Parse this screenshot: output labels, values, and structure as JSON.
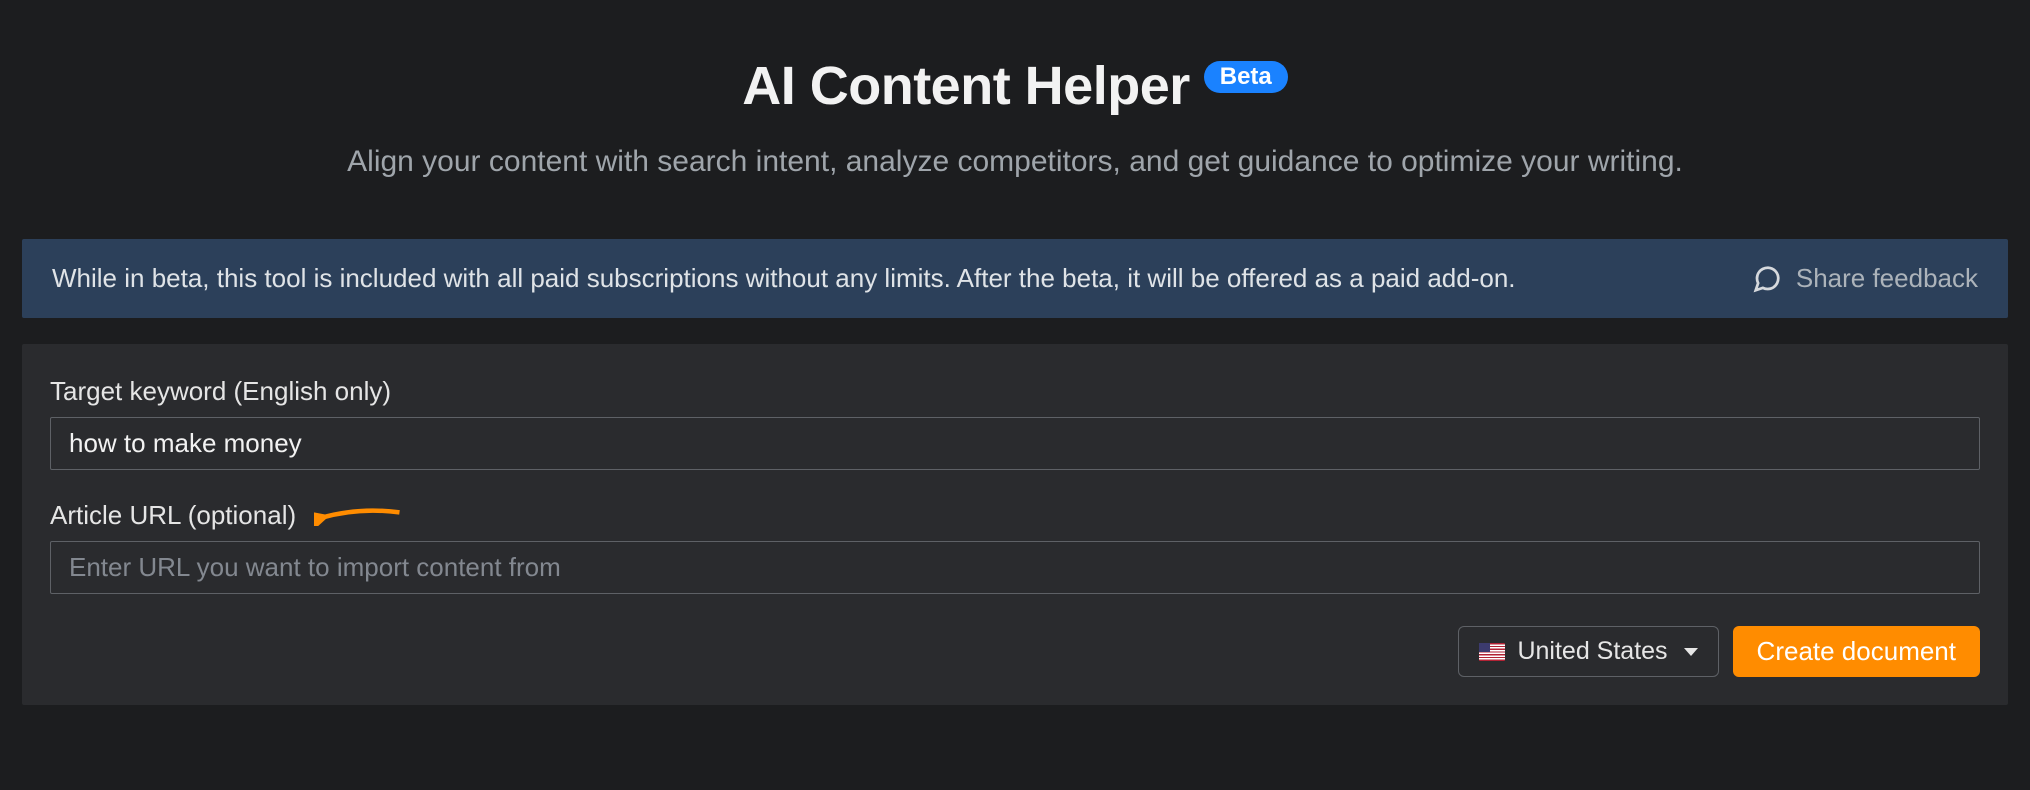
{
  "header": {
    "title": "AI Content Helper",
    "badge": "Beta",
    "subtitle": "Align your content with search intent, analyze competitors, and get guidance to optimize your writing."
  },
  "notice": {
    "text": "While in beta, this tool is included with all paid subscriptions without any limits. After the beta, it will be offered as a paid add-on.",
    "feedback_label": "Share feedback"
  },
  "form": {
    "keyword_label": "Target keyword (English only)",
    "keyword_value": "how to make money",
    "url_label": "Article URL (optional)",
    "url_placeholder": "Enter URL you want to import content from",
    "url_value": "",
    "country_selected": "United States",
    "submit_label": "Create document"
  },
  "colors": {
    "accent": "#ff8c00",
    "badge": "#1a82ff",
    "notice_bg": "#2c405a",
    "panel_bg": "#2a2b2e",
    "page_bg": "#1c1d1f"
  }
}
